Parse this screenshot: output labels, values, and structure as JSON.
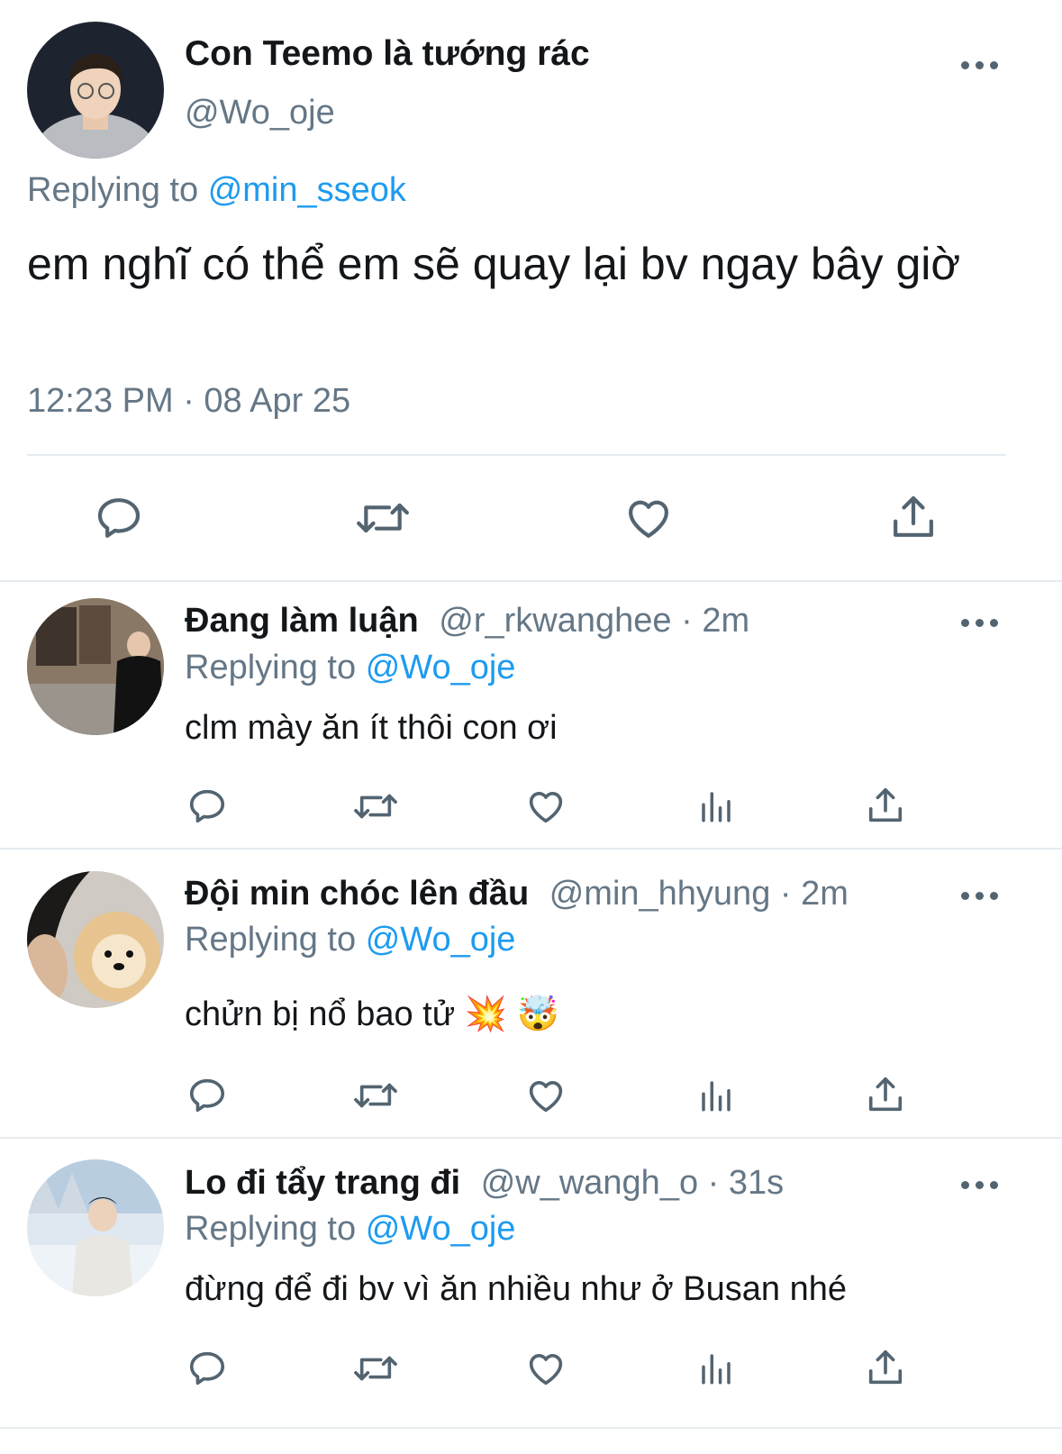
{
  "main_tweet": {
    "display_name": "Con Teemo là tướng rác",
    "handle": "@Wo_oje",
    "replying_prefix": "Replying to",
    "replying_handle": "@min_sseok",
    "text": "em nghĩ có thể em sẽ quay lại bv ngay bây giờ",
    "timestamp": "12:23 PM · 08 Apr 25"
  },
  "replies": [
    {
      "display_name": "Đang làm luận",
      "handle": "@r_rkwanghee",
      "time": "· 2m",
      "replying_prefix": "Replying to",
      "replying_handle": "@Wo_oje",
      "text": "clm mày ăn ít thôi con ơi"
    },
    {
      "display_name": "Đội min chóc lên đầu",
      "handle": "@min_hhyung",
      "time": "· 2m",
      "replying_prefix": "Replying to",
      "replying_handle": "@Wo_oje",
      "text": "chửn bị nổ bao tử 💥 🤯"
    },
    {
      "display_name": "Lo đi tẩy trang đi",
      "handle": "@w_wangh_o",
      "time": "· 31s",
      "replying_prefix": "Replying to",
      "replying_handle": "@Wo_oje",
      "text": "đừng để đi bv vì ăn nhiều như ở Busan nhé"
    }
  ],
  "icons": [
    "more-icon",
    "reply-icon",
    "retweet-icon",
    "like-icon",
    "share-icon",
    "analytics-icon"
  ],
  "colors": {
    "link": "#1d9bf0",
    "secondary_text": "#657786",
    "icon": "#536471",
    "divider": "#e6ecf0"
  }
}
